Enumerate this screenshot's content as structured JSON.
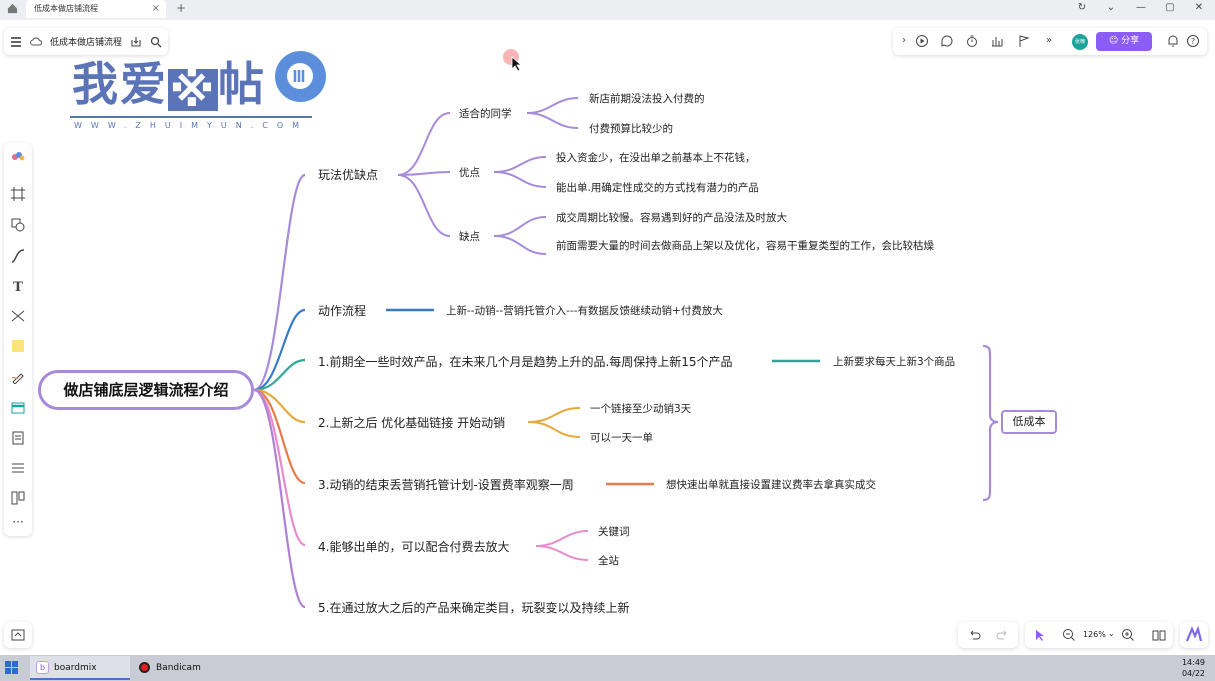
{
  "browser": {
    "tab_title": "低成本做店铺流程",
    "close": "×",
    "new_tab": "+",
    "window": {
      "refresh": "↻",
      "dropdown": "⌄",
      "minimize": "—",
      "restore": "▢",
      "close": "✕"
    }
  },
  "toolbar": {
    "doc_title": "低成本做店铺流程",
    "share_label": "分享",
    "avatar_text": "张楠"
  },
  "watermark": {
    "text": "我爱",
    "text2": "帖",
    "text_mark": "※",
    "url": "WWW.ZHUIMYUN.COM"
  },
  "mindmap": {
    "root": "做店铺底层逻辑流程介绍",
    "branches": [
      {
        "label": "玩法优缺点",
        "color": "#a78bd9",
        "children": [
          {
            "label": "适合的同学",
            "leaves": [
              "新店前期没法投入付费的",
              "付费预算比较少的"
            ]
          },
          {
            "label": "优点",
            "leaves": [
              "投入资金少，在没出单之前基本上不花钱，",
              "能出单.用确定性成交的方式找有潜力的产品"
            ]
          },
          {
            "label": "缺点",
            "leaves": [
              "成交周期比较慢。容易遇到好的产品没法及时放大",
              "前面需要大量的时间去做商品上架以及优化，容易干重复类型的工作，会比较枯燥"
            ]
          }
        ]
      },
      {
        "label": "动作流程",
        "color": "#3a7bc8",
        "note": "上新--动销--营销托管介入---有数据反馈继续动销+付费放大"
      },
      {
        "label": "1.前期全一些时效产品，在未来几个月是趋势上升的品.每周保持上新15个产品",
        "color": "#2fa89a",
        "note": "上新要求每天上新3个商品"
      },
      {
        "label": "2.上新之后 优化基础链接 开始动销",
        "color": "#e8a93b",
        "leaves": [
          "一个链接至少动销3天",
          "可以一天一单"
        ]
      },
      {
        "label": "3.动销的结束丢营销托管计划-设置费率观察一周",
        "color": "#e87b4a",
        "note": "想快速出单就直接设置建议费率去拿真实成交"
      },
      {
        "label": "4.能够出单的，可以配合付费去放大",
        "color": "#e88bcb",
        "leaves": [
          "关键词",
          "全站"
        ]
      },
      {
        "label": "5.在通过放大之后的产品来确定类目，玩裂变以及持续上新",
        "color": "#b07fd6"
      }
    ],
    "bracket_label": "低成本"
  },
  "zoom": {
    "level": "126%"
  },
  "taskbar": {
    "apps": [
      "boardmix",
      "Bandicam"
    ],
    "time": "14:49",
    "date": "04/22"
  }
}
